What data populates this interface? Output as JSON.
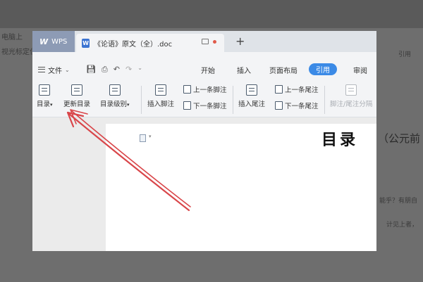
{
  "background": {
    "left_text_1": "电脑上",
    "left_text_2": "视光标定位",
    "right_peek_1": "引用",
    "right_peek_2": "（公元前",
    "right_peek_3": "能乎？有朋自",
    "right_peek_4": "计见上者，"
  },
  "titlebar": {
    "app_label": "WPS",
    "document_tab": "《论语》原文（全）.doc",
    "new_tab": "+"
  },
  "menubar": {
    "file_label": "文件",
    "tabs": [
      {
        "label": "开始"
      },
      {
        "label": "插入"
      },
      {
        "label": "页面布局"
      },
      {
        "label": "引用"
      },
      {
        "label": "审阅"
      }
    ]
  },
  "toolbar": {
    "toc": "目录",
    "update_toc": "更新目录",
    "toc_level": "目录级别",
    "insert_footnote": "插入脚注",
    "prev_footnote": "上一条脚注",
    "next_footnote": "下一条脚注",
    "insert_endnote": "插入尾注",
    "prev_endnote": "上一条尾注",
    "next_endnote": "下一条尾注",
    "footnote_separator": "脚注/尾注分隔"
  },
  "document": {
    "heading": "目录"
  },
  "colors": {
    "active_tab": "#3b8ae6",
    "arrow": "#d9464a",
    "wps_tab": "#8d9bb5"
  }
}
